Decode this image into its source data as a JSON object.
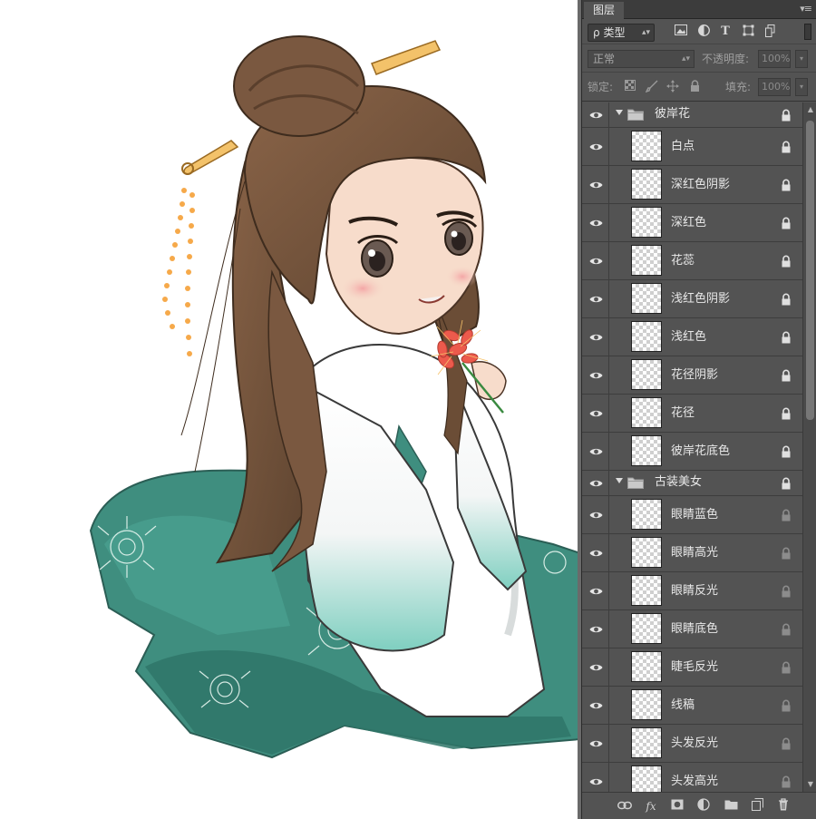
{
  "panel": {
    "tab_label": "图层",
    "filter": {
      "label": "类型",
      "search_glyph": "ρ"
    },
    "filter_icons": [
      "image-filter-icon",
      "adjustment-filter-icon",
      "type-filter-icon",
      "shape-filter-icon",
      "smart-object-filter-icon"
    ],
    "type_glyph": "T",
    "blend_mode": "正常",
    "opacity_label": "不透明度:",
    "opacity_value": "100%",
    "lock_label": "锁定:",
    "fill_label": "填充:",
    "fill_value": "100%"
  },
  "groups": [
    {
      "name": "彼岸花",
      "layers": [
        "白点",
        "深红色阴影",
        "深红色",
        "花蕊",
        "浅红色阴影",
        "浅红色",
        "花径阴影",
        "花径",
        "彼岸花底色"
      ]
    },
    {
      "name": "古装美女",
      "layers": [
        "眼睛蓝色",
        "眼睛高光",
        "眼睛反光",
        "眼睛底色",
        "睫毛反光",
        "线稿",
        "头发反光",
        "头发高光"
      ]
    }
  ],
  "footer": {
    "fx_label": "fx",
    "icons": [
      "link-layers-icon",
      "fx-icon",
      "add-mask-icon",
      "adjustment-layer-icon",
      "new-group-icon",
      "new-layer-icon",
      "delete-layer-icon"
    ]
  },
  "colors": {
    "panel_bg": "#535353",
    "robe_green": "#3e8f80",
    "hair_brown": "#7a5a40",
    "flower_red": "#e8584a",
    "hairpin_gold": "#f0b050"
  }
}
